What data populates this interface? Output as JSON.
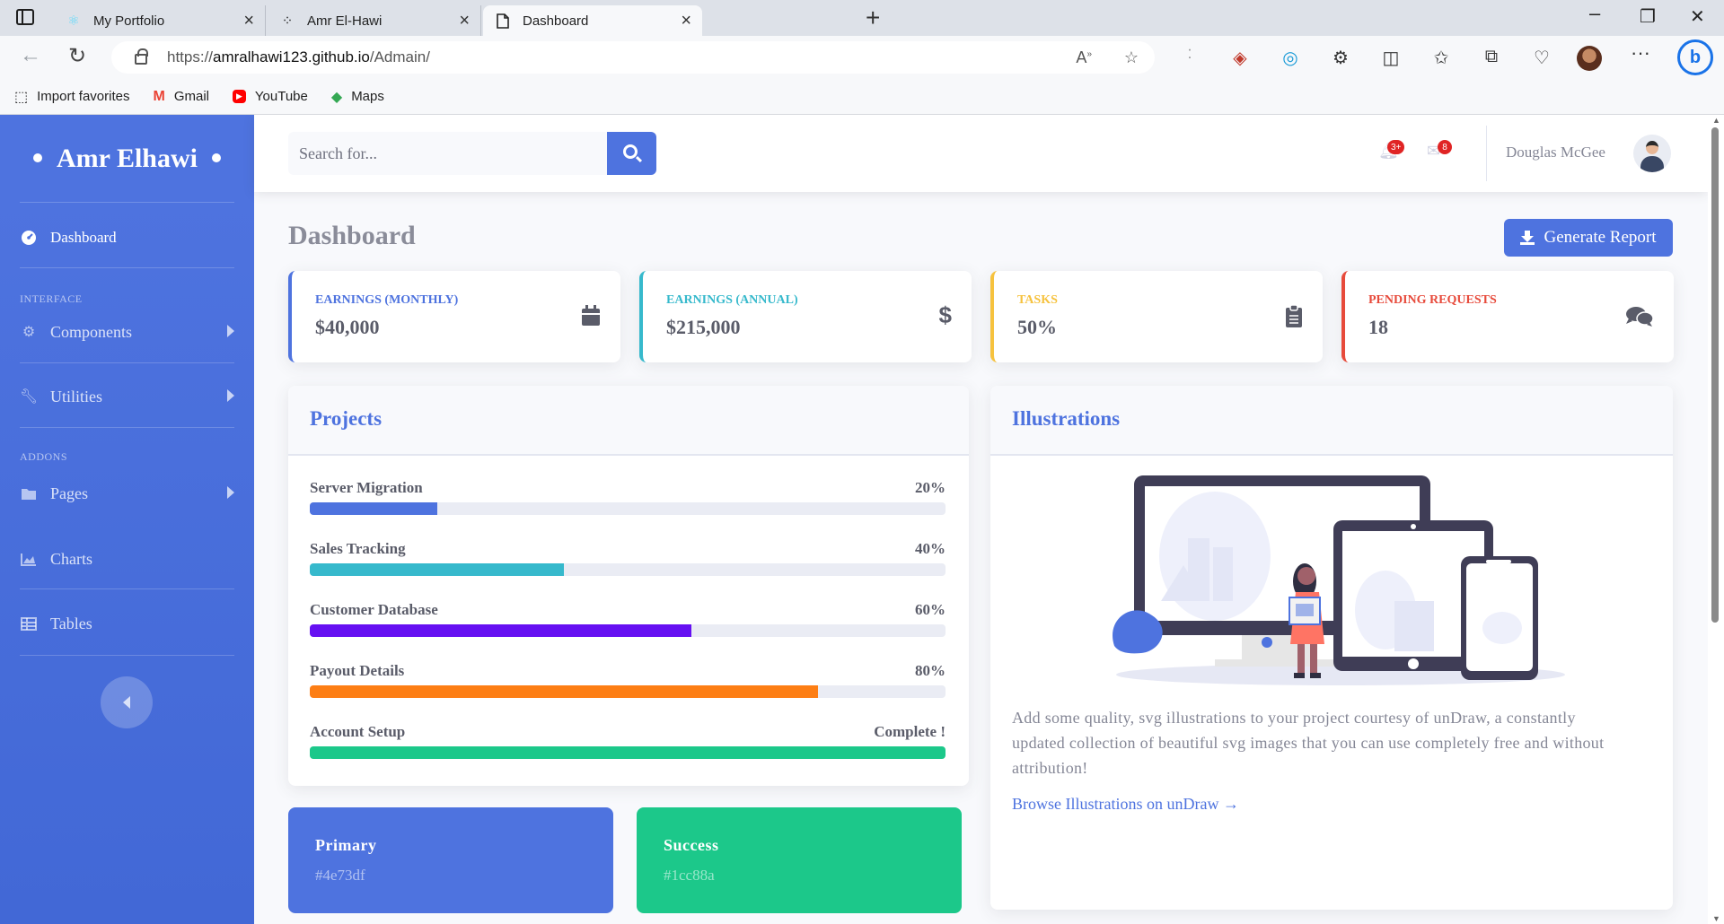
{
  "browser": {
    "tabs": [
      {
        "title": "My Portfolio",
        "icon": "react-icon"
      },
      {
        "title": "Amr El-Hawi",
        "icon": "dots-icon"
      },
      {
        "title": "Dashboard",
        "icon": "page-icon"
      }
    ],
    "url_prefix": "https://",
    "url_host": "amralhawi123.github.io",
    "url_path": "/Admain/",
    "favorites": [
      {
        "label": "Import favorites",
        "icon": "import-icon"
      },
      {
        "label": "Gmail",
        "icon": "gmail-icon"
      },
      {
        "label": "YouTube",
        "icon": "youtube-icon"
      },
      {
        "label": "Maps",
        "icon": "maps-icon"
      }
    ]
  },
  "sidebar": {
    "brand": "Amr Elhawi",
    "dashboard": "Dashboard",
    "heading_interface": "INTERFACE",
    "components": "Components",
    "utilities": "Utilities",
    "heading_addons": "ADDONS",
    "pages": "Pages",
    "charts": "Charts",
    "tables": "Tables",
    "accent": "#4e73df"
  },
  "topbar": {
    "search_placeholder": "Search for...",
    "alerts_badge": "3+",
    "messages_badge": "8",
    "user_name": "Douglas McGee"
  },
  "main": {
    "title": "Dashboard",
    "generate_report": "Generate Report",
    "stats": [
      {
        "label": "EARNINGS (MONTHLY)",
        "value": "$40,000",
        "color": "#4e73df",
        "icon": "calendar-icon"
      },
      {
        "label": "EARNINGS (ANNUAL)",
        "value": "$215,000",
        "color": "#36b9cc",
        "icon": "dollar-icon"
      },
      {
        "label": "TASKS",
        "value": "50%",
        "color": "#f6c23e",
        "icon": "clipboard-icon"
      },
      {
        "label": "PENDING REQUESTS",
        "value": "18",
        "color": "#e74a3b",
        "icon": "comments-icon"
      }
    ],
    "projects": {
      "title": "Projects",
      "items": [
        {
          "name": "Server Migration",
          "value_text": "20%",
          "progress": 0.2,
          "color": "#4e73df"
        },
        {
          "name": "Sales Tracking",
          "value_text": "40%",
          "progress": 0.4,
          "color": "#36b9cc"
        },
        {
          "name": "Customer Database",
          "value_text": "60%",
          "progress": 0.6,
          "color": "#6610f2"
        },
        {
          "name": "Payout Details",
          "value_text": "80%",
          "progress": 0.8,
          "color": "#fd7e14"
        },
        {
          "name": "Account Setup",
          "value_text": "Complete !",
          "progress": 1.0,
          "color": "#1cc88a"
        }
      ]
    },
    "illustrations": {
      "title": "Illustrations",
      "text": "Add some quality, svg illustrations to your project courtesy of unDraw, a constantly updated collection of beautiful svg images that you can use completely free and without attribution!",
      "link": "Browse Illustrations on unDraw →"
    },
    "color_cards": [
      {
        "name": "Primary",
        "hex": "#4e73df"
      },
      {
        "name": "Success",
        "hex": "#1cc88a"
      }
    ]
  }
}
